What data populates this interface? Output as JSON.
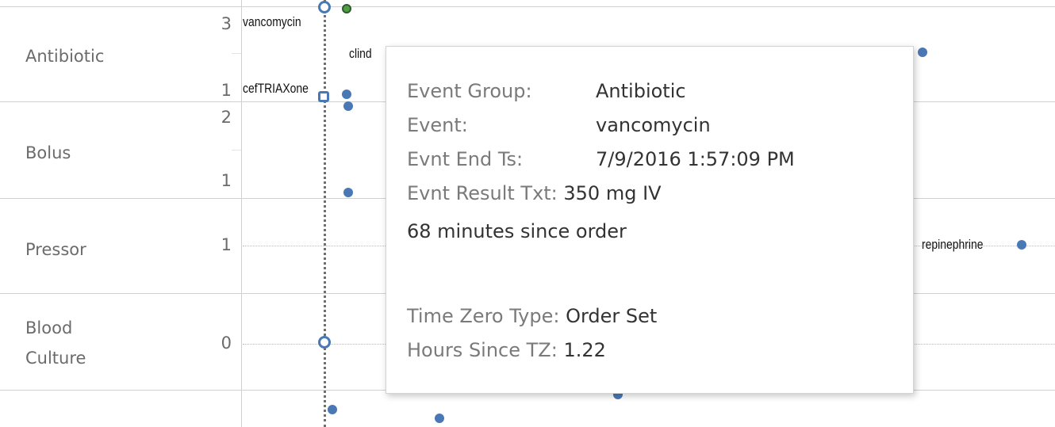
{
  "rows": [
    {
      "label_lines": [
        "Antibiotic"
      ],
      "ticks": [
        "3",
        "1"
      ]
    },
    {
      "label_lines": [
        "Bolus"
      ],
      "ticks": [
        "2",
        "1"
      ]
    },
    {
      "label_lines": [
        "Pressor"
      ],
      "ticks": [
        "1"
      ]
    },
    {
      "label_lines": [
        "Blood",
        "Culture"
      ],
      "ticks": [
        "0"
      ]
    }
  ],
  "mark_labels": {
    "vancomycin": "vancomycin",
    "clind": "clind",
    "ceftriaxone": "cefTRIAXone",
    "norepinephrine": "repinephrine"
  },
  "colors": {
    "mark_blue": "#4a78b5",
    "mark_green": "#4f9e42",
    "gridline": "#d0d0d0"
  },
  "tooltip": {
    "fields": [
      {
        "key": "Event Group:",
        "value": "Antibiotic"
      },
      {
        "key": "Event:",
        "value": "vancomycin"
      },
      {
        "key": "Evnt End Ts:",
        "value": "7/9/2016 1:57:09 PM"
      },
      {
        "key": "Evnt Result Txt:",
        "value": "350 mg IV"
      }
    ],
    "note": "68 minutes since order",
    "tz_fields": [
      {
        "key": "Time Zero Type:",
        "value": "Order Set"
      },
      {
        "key": "Hours Since TZ:",
        "value": "1.22"
      }
    ]
  }
}
